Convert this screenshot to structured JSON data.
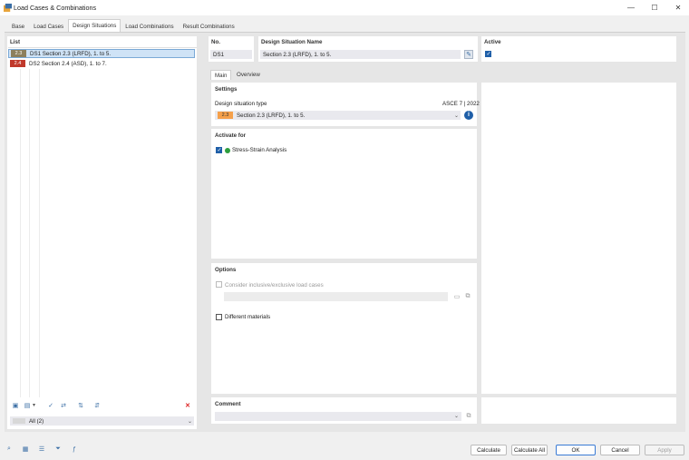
{
  "window": {
    "title": "Load Cases & Combinations"
  },
  "tabs": [
    "Base",
    "Load Cases",
    "Design Situations",
    "Load Combinations",
    "Result Combinations"
  ],
  "list": {
    "header": "List",
    "items": [
      {
        "badge": "2.3",
        "badge_color": "#8c7f5d",
        "id": "DS1",
        "name": "Section 2.3 (LRFD), 1. to 5."
      },
      {
        "badge": "2.4",
        "badge_color": "#c0392b",
        "id": "DS2",
        "name": "Section 2.4 (ASD), 1. to 7."
      }
    ],
    "filter_value": "All (2)"
  },
  "header_fields": {
    "no_label": "No.",
    "no_value": "DS1",
    "name_label": "Design Situation Name",
    "name_value": "Section 2.3 (LRFD), 1. to 5.",
    "active_label": "Active"
  },
  "subtabs": [
    "Main",
    "Overview"
  ],
  "settings": {
    "header": "Settings",
    "type_label": "Design situation type",
    "standard": "ASCE 7 | 2022",
    "type_badge": "2.3",
    "type_value": "Section 2.3 (LRFD), 1. to 5."
  },
  "activate": {
    "header": "Activate for",
    "item": "Stress-Strain Analysis",
    "dot_color": "#2e9e3e"
  },
  "options": {
    "header": "Options",
    "inclusive_label": "Consider inclusive/exclusive load cases",
    "materials_label": "Different materials"
  },
  "comment": {
    "header": "Comment"
  },
  "buttons": {
    "calculate": "Calculate",
    "calculate_all": "Calculate All",
    "ok": "OK",
    "cancel": "Cancel",
    "apply": "Apply"
  },
  "colors": {
    "accent": "#1f5fa8",
    "badge_orange": "#f5a04a"
  }
}
